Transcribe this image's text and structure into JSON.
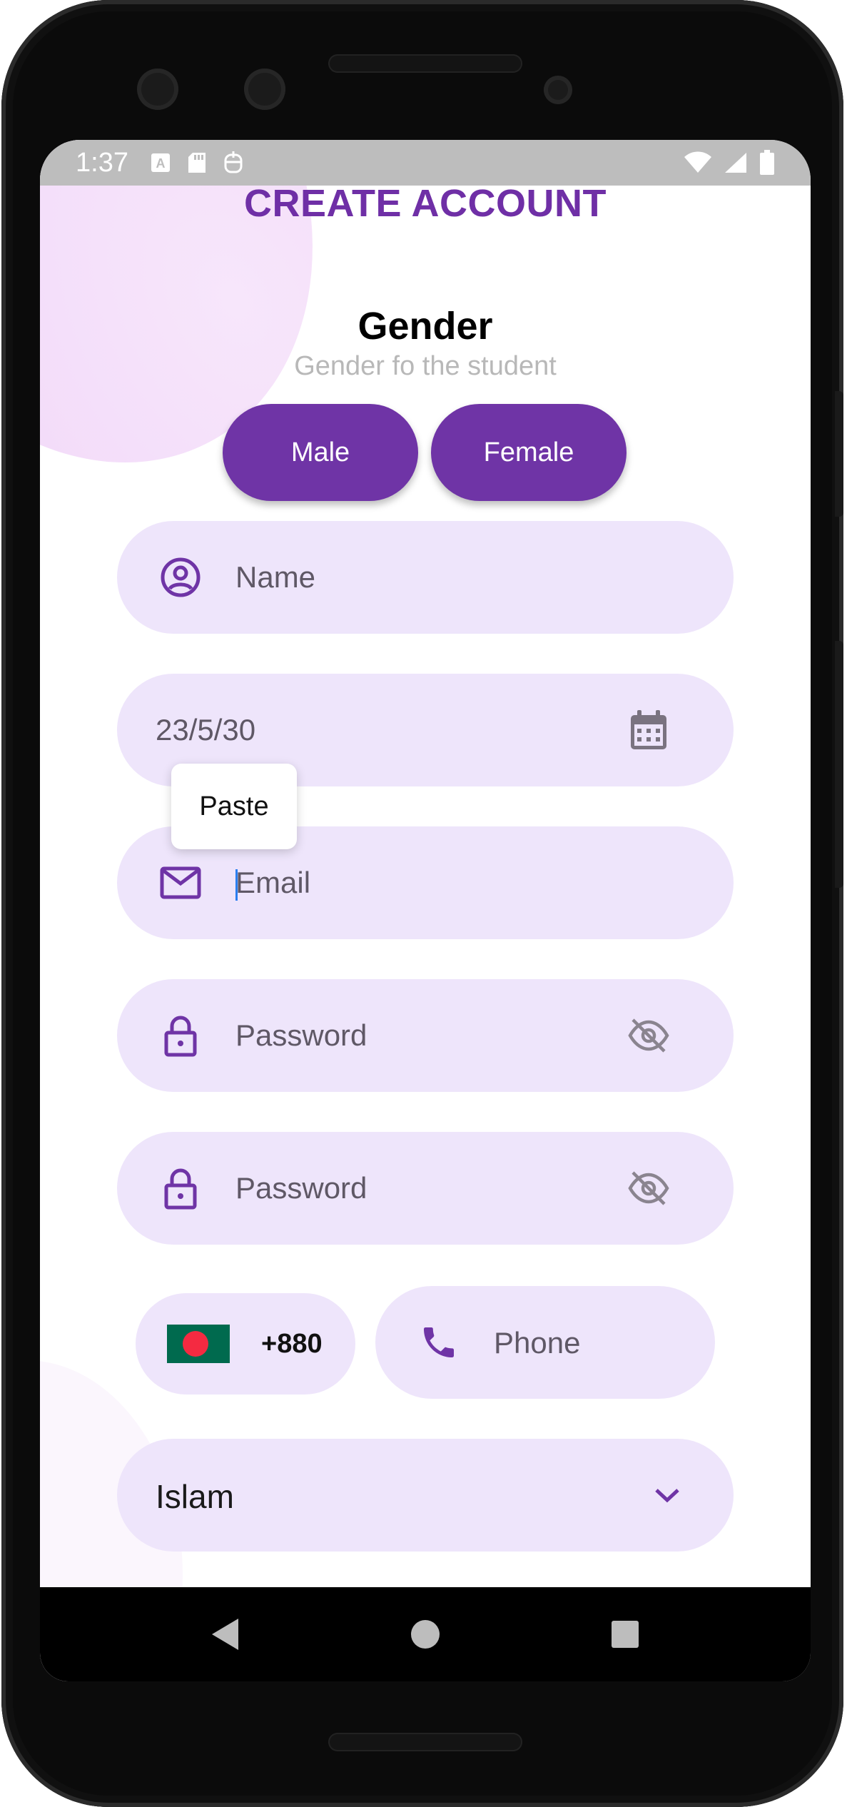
{
  "status_bar": {
    "time": "1:37",
    "left_icons": [
      "text-a-icon",
      "sd-card-icon",
      "privacy-icon"
    ],
    "right_icons": [
      "wifi-icon",
      "signal-icon",
      "battery-icon"
    ]
  },
  "header": {
    "title": "CREATE ACCOUNT"
  },
  "gender": {
    "heading": "Gender",
    "subtitle": "Gender fo the student",
    "options": [
      "Male",
      "Female"
    ]
  },
  "form": {
    "name_placeholder": "Name",
    "dob_value": "23/5/30",
    "email_placeholder": "Email",
    "password_placeholder": "Password",
    "confirm_password_placeholder": "Password",
    "country_code": "+880",
    "phone_placeholder": "Phone",
    "religion_value": "Islam"
  },
  "context_menu": {
    "paste_label": "Paste"
  },
  "colors": {
    "primary": "#6f34a6",
    "field_bg": "#eee5fb",
    "title": "#6f2fa6",
    "subtitle": "#b8b8b8"
  }
}
